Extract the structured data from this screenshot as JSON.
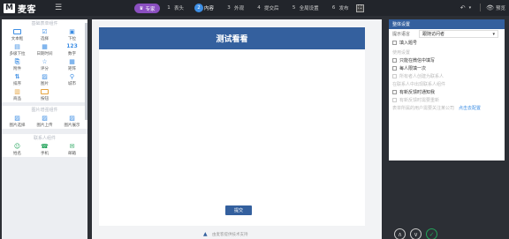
{
  "app": {
    "logo_mark": "M",
    "logo_text": "麦客"
  },
  "topbar": {
    "pro_badge": "专家",
    "steps": [
      {
        "num": "1",
        "label": "表头"
      },
      {
        "num": "2",
        "label": "内容"
      },
      {
        "num": "3",
        "label": "外观"
      },
      {
        "num": "4",
        "label": "提交后"
      },
      {
        "num": "5",
        "label": "全局设置"
      },
      {
        "num": "6",
        "label": "发布"
      }
    ],
    "active_step": 2,
    "preview_label": "预览"
  },
  "left_panel": {
    "basic": {
      "title": "基础表单组件",
      "items": [
        {
          "label": "文本框",
          "icon": "textbox-icon"
        },
        {
          "label": "选择",
          "icon": "radio-icon"
        },
        {
          "label": "下拉",
          "icon": "dropdown-icon"
        },
        {
          "label": "多级下拉",
          "icon": "cascade-icon"
        },
        {
          "label": "日期时间",
          "icon": "calendar-icon"
        },
        {
          "label": "数字",
          "icon_text": "123"
        },
        {
          "label": "附件",
          "icon": "attachment-icon"
        },
        {
          "label": "评分",
          "icon": "star-icon"
        },
        {
          "label": "矩阵",
          "icon": "grid-icon"
        },
        {
          "label": "排序",
          "icon": "sort-icon"
        },
        {
          "label": "图片",
          "icon": "image-icon"
        },
        {
          "label": "城市",
          "icon": "location-icon"
        },
        {
          "label": "商品",
          "icon": "cart-icon"
        },
        {
          "label": "按钮",
          "icon": "button-icon"
        }
      ]
    },
    "image": {
      "title": "图片增强组件",
      "items": [
        {
          "label": "图片选择",
          "icon": "image-select-icon"
        },
        {
          "label": "图片上传",
          "icon": "image-upload-icon"
        },
        {
          "label": "图片展示",
          "icon": "image-display-icon"
        }
      ]
    },
    "contact": {
      "title": "联系人组件",
      "items": [
        {
          "label": "姓名",
          "icon": "person-icon"
        },
        {
          "label": "手机",
          "icon": "phone-icon"
        },
        {
          "label": "邮箱",
          "icon": "mail-icon"
        }
      ]
    }
  },
  "form": {
    "title": "测试看看",
    "submit_label": "提交",
    "footer_note": "由麦客提供技术支持"
  },
  "right_panel": {
    "title": "整体设置",
    "prompt_label": "提示语言",
    "prompt_value": "跟随访问者",
    "number_questions": "填入题号",
    "share_title": "使用设置",
    "only_wechat": "只能在微信中填写",
    "once_per_person": "每人限填一次",
    "owner_create": "所有者人创建为联系人",
    "contact_title": "在联系人中出现联系人组件",
    "notify_new": "有新反馈时通知我",
    "notify_edit": "有新反馈时需要重新",
    "company_text": "表单所属的用户需要关注某公司",
    "company_link": "点击去配置"
  },
  "accent_colors": {
    "header": "#34609e",
    "active_step": "#3d8ee4",
    "badge": "#8a4fc0"
  }
}
